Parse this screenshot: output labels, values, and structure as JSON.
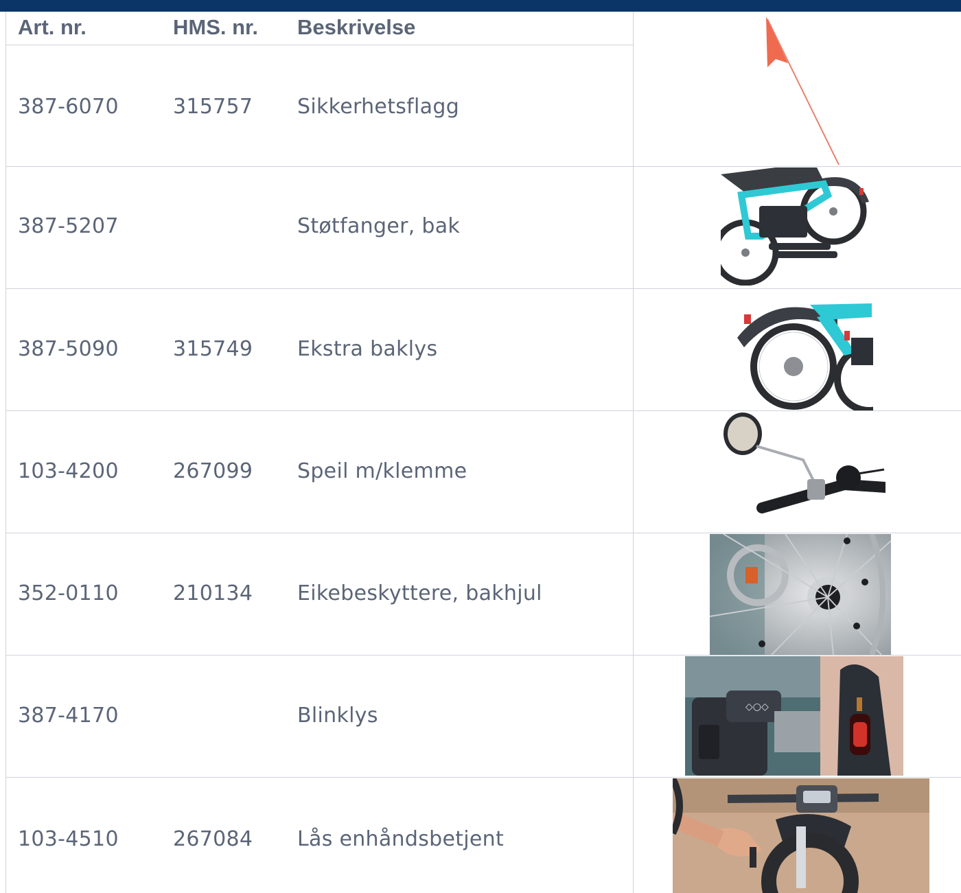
{
  "table": {
    "headers": {
      "art_nr": "Art. nr.",
      "hms_nr": "HMS. nr.",
      "beskrivelse": "Beskrivelse"
    },
    "rows": [
      {
        "art_nr": "387-6070",
        "hms_nr": "315757",
        "beskrivelse": "Sikkerhetsflagg",
        "image": "safety-flag"
      },
      {
        "art_nr": "387-5207",
        "hms_nr": "",
        "beskrivelse": "Støtfanger, bak",
        "image": "rear-bumper"
      },
      {
        "art_nr": "387-5090",
        "hms_nr": "315749",
        "beskrivelse": "Ekstra baklys",
        "image": "extra-rear-light"
      },
      {
        "art_nr": "103-4200",
        "hms_nr": "267099",
        "beskrivelse": "Speil m/klemme",
        "image": "mirror-with-clamp"
      },
      {
        "art_nr": "352-0110",
        "hms_nr": "210134",
        "beskrivelse": "Eikebeskyttere, bakhjul",
        "image": "spoke-guard"
      },
      {
        "art_nr": "387-4170",
        "hms_nr": "",
        "beskrivelse": "Blinklys",
        "image": "turn-signal"
      },
      {
        "art_nr": "103-4510",
        "hms_nr": "267084",
        "beskrivelse": "Lås enhåndsbetjent",
        "image": "one-hand-lock"
      }
    ]
  },
  "colors": {
    "header_bar": "#0b3566",
    "text": "#5b6577",
    "grid": "#cfd3da",
    "frame_teal": "#2ec9d4"
  }
}
